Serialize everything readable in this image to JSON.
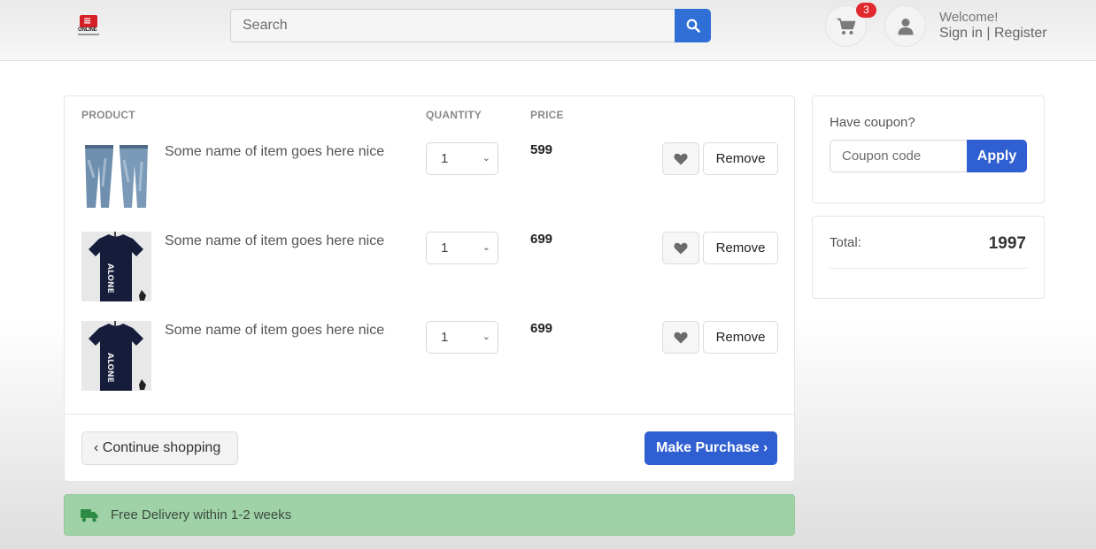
{
  "header": {
    "logo_text": "ONLINE",
    "search_placeholder": "Search",
    "cart_count": "3",
    "welcome": "Welcome!",
    "sign_in": "Sign in",
    "separator": "|",
    "register": "Register"
  },
  "cart": {
    "columns": {
      "product": "PRODUCT",
      "quantity": "QUANTITY",
      "price": "PRICE"
    },
    "items": [
      {
        "name": "Some name of item goes here nice",
        "qty": "1",
        "price": "599",
        "image": "jeans"
      },
      {
        "name": "Some name of item goes here nice",
        "qty": "1",
        "price": "699",
        "image": "tshirt"
      },
      {
        "name": "Some name of item goes here nice",
        "qty": "1",
        "price": "699",
        "image": "tshirt"
      }
    ],
    "remove_label": "Remove",
    "continue_label": "Continue shopping",
    "purchase_label": "Make Purchase"
  },
  "delivery": {
    "message": "Free Delivery within 1-2 weeks"
  },
  "coupon": {
    "label": "Have coupon?",
    "placeholder": "Coupon code",
    "apply_label": "Apply"
  },
  "summary": {
    "total_label": "Total:",
    "total_value": "1997"
  },
  "colors": {
    "primary": "#2f5fd0",
    "badge": "#e0282d",
    "success_bg": "#9fd3a7"
  }
}
